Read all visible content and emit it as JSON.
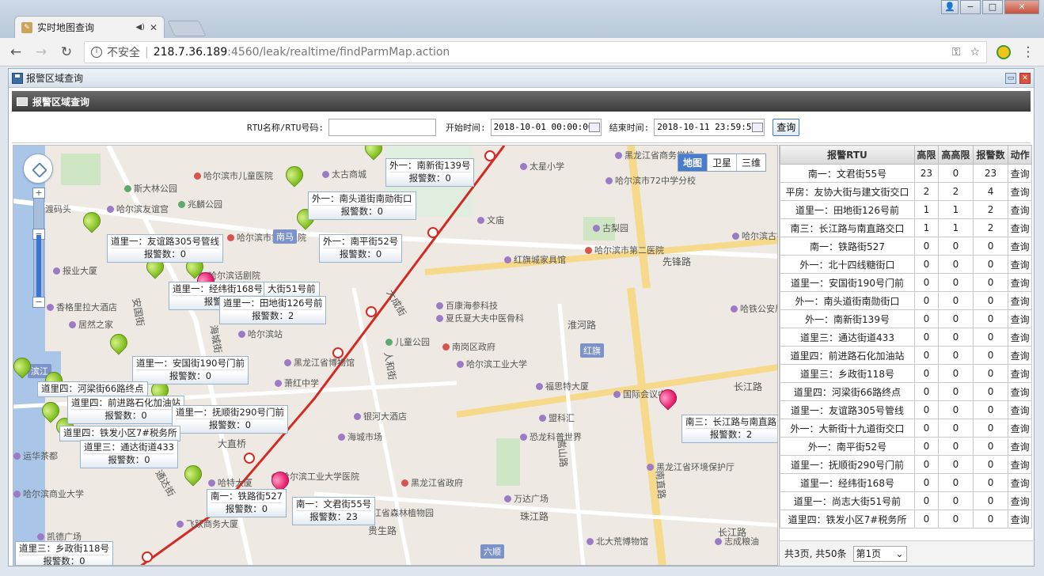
{
  "browser": {
    "tab_title": "实时地图查询",
    "tab_audio": "◀)",
    "tab_close": "✕",
    "window_buttons": {
      "user": "👤",
      "min": "−",
      "max": "□",
      "close": "✕"
    },
    "url_insecure": "不安全",
    "url_host": "218.7.36.189",
    "url_rest": ":4560/leak/realtime/findParmMap.action"
  },
  "app": {
    "header_title": "报警区域查询",
    "panel_title": "报警区域查询",
    "search": {
      "rtu_label": "RTU名称/RTU号码:",
      "rtu_value": "",
      "start_label": "开始时间:",
      "start_value": "2018-10-01 00:00:00",
      "end_label": "结束时间:",
      "end_value": "2018-10-11 23:59:59",
      "query_label": "查询"
    }
  },
  "map": {
    "type_buttons": [
      "地图",
      "卫星",
      "三维"
    ],
    "zoom_in": "+",
    "zoom_out": "−",
    "badges": [
      "南马",
      "红旗",
      "六顺",
      "滨江"
    ],
    "places": [
      {
        "t": "太古商城",
        "c": ""
      },
      {
        "t": "哈尔滨市儿童医院",
        "c": "red"
      },
      {
        "t": "斯大林公园",
        "c": "grn"
      },
      {
        "t": "哈尔滨友谊宫",
        "c": ""
      },
      {
        "t": "兆麟公园",
        "c": "grn"
      },
      {
        "t": "哈尔滨市第一医院",
        "c": "red"
      },
      {
        "t": "报业大厦",
        "c": ""
      },
      {
        "t": "哈尔滨话剧院",
        "c": ""
      },
      {
        "t": "香格里拉大酒店",
        "c": ""
      },
      {
        "t": "居然之家",
        "c": ""
      },
      {
        "t": "哈尔滨站",
        "c": ""
      },
      {
        "t": "儿童公园",
        "c": "grn"
      },
      {
        "t": "黑龙江省博物馆",
        "c": ""
      },
      {
        "t": "萧红中学",
        "c": ""
      },
      {
        "t": "银河大酒店",
        "c": ""
      },
      {
        "t": "海城市场",
        "c": ""
      },
      {
        "t": "哈特大厦",
        "c": ""
      },
      {
        "t": "哈尔滨工业大学医院",
        "c": "red"
      },
      {
        "t": "飞跃商务大厦",
        "c": ""
      },
      {
        "t": "凯德广场",
        "c": ""
      },
      {
        "t": "黑龙江省政府",
        "c": "red"
      },
      {
        "t": "南岗区政府",
        "c": "red"
      },
      {
        "t": "哈尔滨工业大学",
        "c": ""
      },
      {
        "t": "福思特大厦",
        "c": ""
      },
      {
        "t": "盟科汇",
        "c": ""
      },
      {
        "t": "恐龙科普世界",
        "c": ""
      },
      {
        "t": "万达广场",
        "c": ""
      },
      {
        "t": "黑龙江省森林植物园",
        "c": "grn"
      },
      {
        "t": "北大荒博物馆",
        "c": ""
      },
      {
        "t": "红旗城家具馆",
        "c": ""
      },
      {
        "t": "百康海参科技",
        "c": ""
      },
      {
        "t": "夏氏夏大夫中医骨科",
        "c": ""
      },
      {
        "t": "文庙",
        "c": ""
      },
      {
        "t": "古梨园",
        "c": ""
      },
      {
        "t": "哈尔滨市第二医院",
        "c": "red"
      },
      {
        "t": "太星小学",
        "c": ""
      },
      {
        "t": "哈尔滨市72中学分校",
        "c": ""
      },
      {
        "t": "黑龙江省商务学校",
        "c": ""
      },
      {
        "t": "国际会议中心",
        "c": ""
      },
      {
        "t": "黑龙江省环境保护厅",
        "c": ""
      },
      {
        "t": "哈铁公安局警犬基地",
        "c": ""
      },
      {
        "t": "哈尔滨古铁",
        "c": ""
      },
      {
        "t": "运华茶都",
        "c": ""
      },
      {
        "t": "哈尔滨商业大学",
        "c": ""
      },
      {
        "t": "渡码头",
        "c": ""
      },
      {
        "t": "志成粮油",
        "c": ""
      }
    ],
    "roads": [
      "先锋路",
      "先锋路",
      "淮河路",
      "大成街",
      "人和街",
      "长江路",
      "南直路",
      "嵩山路",
      "珠江路",
      "通达街",
      "安国街",
      "海城街",
      "大直桥",
      "新阳路",
      "贵生路",
      "长江路"
    ],
    "tips": [
      {
        "name": "外一：南新街139号",
        "count": "报警数：0"
      },
      {
        "name": "外一：南头道街南勋街口",
        "count": "报警数：0"
      },
      {
        "name": "外一：南平街52号",
        "count": "报警数：0"
      },
      {
        "name": "道里一：友谊路305号管线",
        "count": "报警数：0"
      },
      {
        "name": "道里一：经纬街168号",
        "count": "报警数"
      },
      {
        "name": "大街51号前",
        "count": ""
      },
      {
        "name": "道里一：田地街126号前",
        "count": "报警数：2"
      },
      {
        "name": "道里一：安国街190号门前",
        "count": "报警数：0"
      },
      {
        "name": "道里四：河梁街66路终点",
        "count": ""
      },
      {
        "name": "道里四：前进路石化加油站",
        "count": "报警数：0"
      },
      {
        "name": "道里一：抚顺街290号门前",
        "count": "报警数：0"
      },
      {
        "name": "道里四：铁发小区7#税务所",
        "count": ""
      },
      {
        "name": "道里三：通达街道433",
        "count": "报警数：0"
      },
      {
        "name": "南一：铁路街527",
        "count": "报警数：0"
      },
      {
        "name": "南一：文君街55号",
        "count": "报警数：23"
      },
      {
        "name": "南三：长江路与南直路",
        "count": "报警数：2"
      },
      {
        "name": "道里三：乡政街118号",
        "count": "报警数：0"
      }
    ]
  },
  "side": {
    "headers": [
      "报警RTU",
      "高限",
      "高高限",
      "报警数",
      "动作"
    ],
    "rows": [
      [
        "南一：文君街55号",
        "23",
        "0",
        "23",
        "查询"
      ],
      [
        "平房：友协大街与建文街交口",
        "2",
        "2",
        "4",
        "查询"
      ],
      [
        "道里一：田地街126号前",
        "1",
        "1",
        "2",
        "查询"
      ],
      [
        "南三：长江路与南直路交口",
        "1",
        "1",
        "2",
        "查询"
      ],
      [
        "南一：铁路街527",
        "0",
        "0",
        "0",
        "查询"
      ],
      [
        "外一：北十四线糖街口",
        "0",
        "0",
        "0",
        "查询"
      ],
      [
        "道里一：安国街190号门前",
        "0",
        "0",
        "0",
        "查询"
      ],
      [
        "外一：南头道街南勋街口",
        "0",
        "0",
        "0",
        "查询"
      ],
      [
        "外一：南新街139号",
        "0",
        "0",
        "0",
        "查询"
      ],
      [
        "道里三：通达街道433",
        "0",
        "0",
        "0",
        "查询"
      ],
      [
        "道里四：前进路石化加油站",
        "0",
        "0",
        "0",
        "查询"
      ],
      [
        "道里三：乡政街118号",
        "0",
        "0",
        "0",
        "查询"
      ],
      [
        "道里四：河梁街66路终点",
        "0",
        "0",
        "0",
        "查询"
      ],
      [
        "道里一：友谊路305号管线",
        "0",
        "0",
        "0",
        "查询"
      ],
      [
        "外一：大新街十九道街交口",
        "0",
        "0",
        "0",
        "查询"
      ],
      [
        "外一：南平街52号",
        "0",
        "0",
        "0",
        "查询"
      ],
      [
        "道里一：抚顺街290号门前",
        "0",
        "0",
        "0",
        "查询"
      ],
      [
        "道里一：经纬街168号",
        "0",
        "0",
        "0",
        "查询"
      ],
      [
        "道里一：尚志大街51号前",
        "0",
        "0",
        "0",
        "查询"
      ],
      [
        "道里四：铁发小区7#税务所",
        "0",
        "0",
        "0",
        "查询"
      ]
    ],
    "pager_text": "共3页, 共50条",
    "page_select": "第1页"
  }
}
